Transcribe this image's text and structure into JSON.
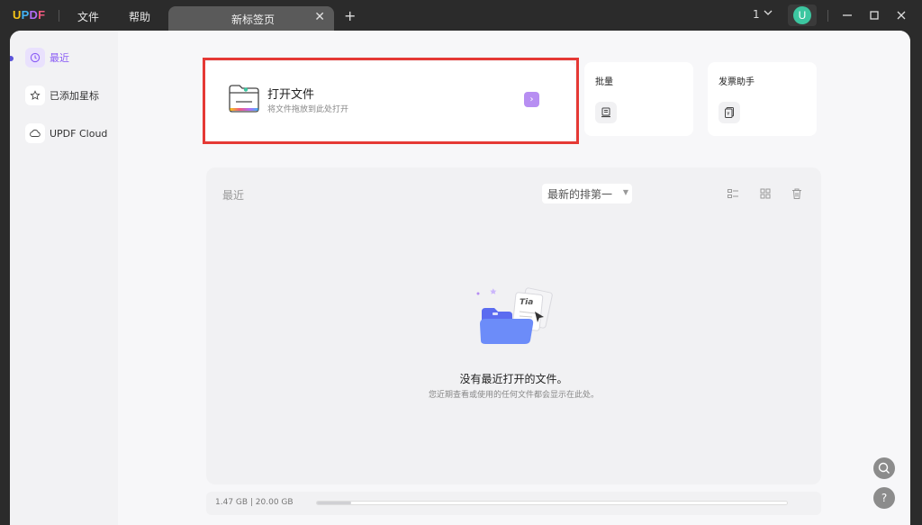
{
  "titlebar": {
    "logo": {
      "u": "U",
      "p": "P",
      "d": "D",
      "f": "F"
    },
    "menus": [
      "文件",
      "帮助"
    ],
    "tab_title": "新标签页",
    "window_count": "1",
    "avatar_letter": "U"
  },
  "sidebar": {
    "items": [
      {
        "label": "最近",
        "icon": "clock-icon",
        "active": true
      },
      {
        "label": "已添加星标",
        "icon": "star-icon",
        "active": false
      },
      {
        "label": "UPDF Cloud",
        "icon": "cloud-icon",
        "active": false
      }
    ]
  },
  "open_file": {
    "title": "打开文件",
    "subtitle": "将文件拖放到此处打开",
    "arrow": "›"
  },
  "cards": {
    "batch": "批量",
    "invoice": "发票助手"
  },
  "recent": {
    "title": "最近",
    "sort": "最新的排第一",
    "empty_title": "没有最近打开的文件。",
    "empty_sub": "您近期查看或使用的任何文件都会显示在此处。"
  },
  "storage": {
    "text": "1.47 GB | 20.00 GB",
    "used_fraction": 0.0735
  },
  "float": {
    "search_icon": "search-icon",
    "help": "?"
  },
  "colors": {
    "accent": "#8a5cf5",
    "highlight_border": "#e53935"
  }
}
